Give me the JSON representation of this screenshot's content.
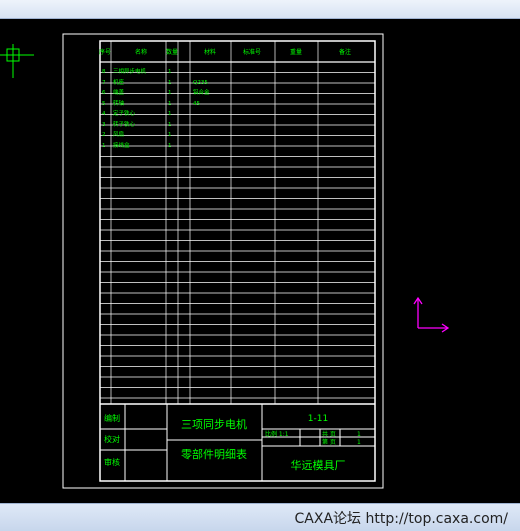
{
  "table": {
    "headers": [
      "序号",
      "名称",
      "数量",
      "材料",
      "标准号",
      "重量",
      "备注"
    ],
    "rows": [
      {
        "no": "8",
        "name": "三相异步电机",
        "qty": "1",
        "material": ""
      },
      {
        "no": "7",
        "name": "机座",
        "qty": "1",
        "material": "Q235"
      },
      {
        "no": "6",
        "name": "端盖",
        "qty": "1",
        "material": "铝合金"
      },
      {
        "no": "5",
        "name": "转轴",
        "qty": "1",
        "material": "45"
      },
      {
        "no": "4",
        "name": "定子铁心",
        "qty": "1",
        "material": ""
      },
      {
        "no": "3",
        "name": "转子铁心",
        "qty": "1",
        "material": ""
      },
      {
        "no": "2",
        "name": "风扇",
        "qty": "1",
        "material": ""
      },
      {
        "no": "1",
        "name": "接线盒",
        "qty": "1",
        "material": ""
      }
    ]
  },
  "titleblock": {
    "role_labels": [
      "编制",
      "校对",
      "审核"
    ],
    "title_line1": "三项同步电机",
    "title_line2": "零部件明细表",
    "code": "1-11",
    "sheet_labels": [
      "共 页",
      "第 页"
    ],
    "sheet_values": [
      "1",
      "1"
    ],
    "scale_label": "比例 1:1",
    "company": "华远模具厂"
  },
  "watermark": "CAXA论坛 http://top.caxa.com/",
  "colors": {
    "background": "#000000",
    "lines": "#ffffff",
    "text": "#00ff00",
    "ucs": "#ff00ff"
  },
  "icons": [
    "crosshair-icon",
    "ucs-axis-icon"
  ]
}
